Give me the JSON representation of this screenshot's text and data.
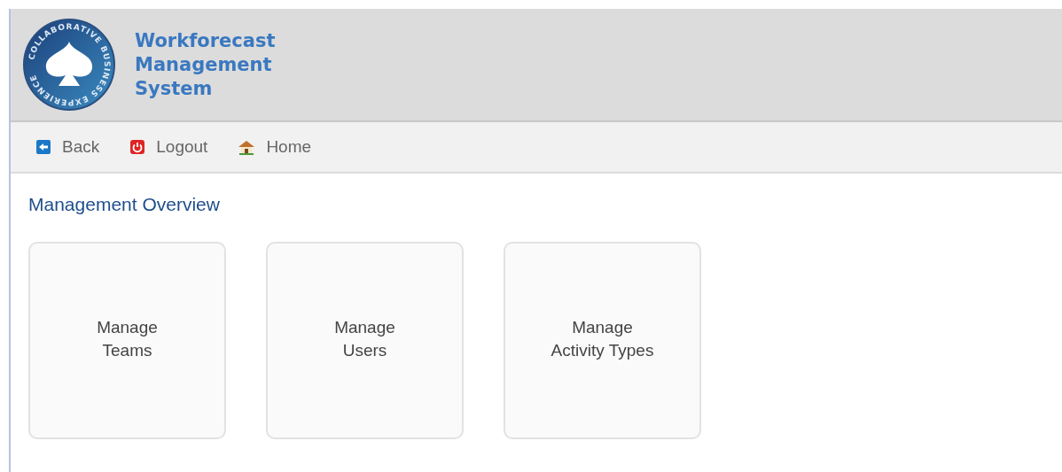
{
  "header": {
    "logo_text": "COLLABORATIVE BUSINESS EXPERIENCE",
    "title": "Workforecast Management System"
  },
  "nav": [
    {
      "kind": "back",
      "label": "Back"
    },
    {
      "kind": "logout",
      "label": "Logout"
    },
    {
      "kind": "home",
      "label": "Home"
    }
  ],
  "page_title": "Management Overview",
  "tiles": [
    {
      "lines": [
        "Manage",
        "Teams"
      ]
    },
    {
      "lines": [
        "Manage",
        "Users"
      ]
    },
    {
      "lines": [
        "Manage",
        "Activity Types"
      ]
    }
  ]
}
